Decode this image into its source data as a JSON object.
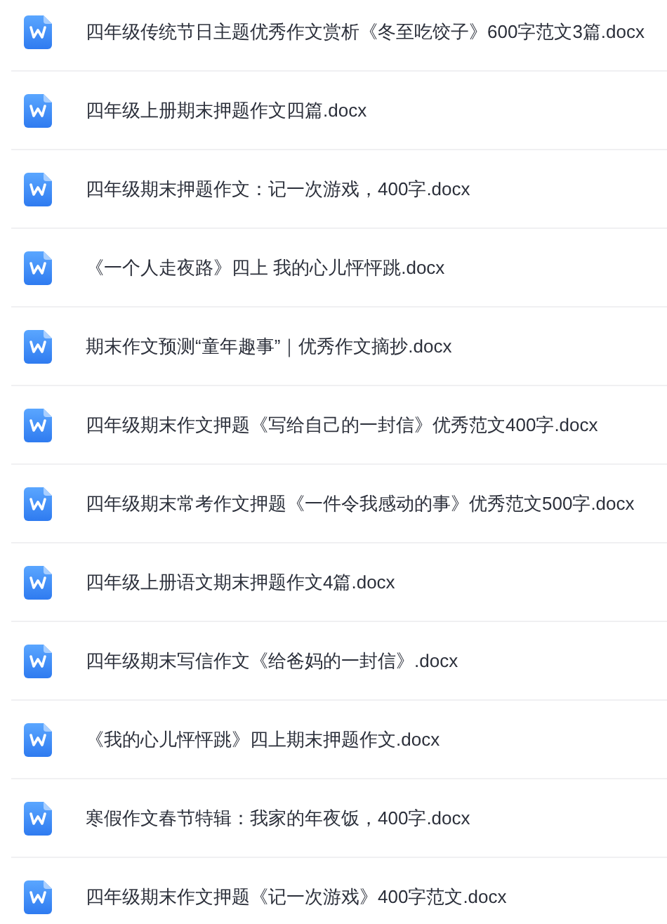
{
  "files": [
    {
      "name": "四年级传统节日主题优秀作文赏析《冬至吃饺子》600字范文3篇.docx",
      "kind": "word"
    },
    {
      "name": "四年级上册期末押题作文四篇.docx",
      "kind": "word"
    },
    {
      "name": "四年级期末押题作文：记一次游戏，400字.docx",
      "kind": "word"
    },
    {
      "name": "《一个人走夜路》四上 我的心儿怦怦跳.docx",
      "kind": "word"
    },
    {
      "name": "期末作文预测“童年趣事”｜优秀作文摘抄.docx",
      "kind": "word"
    },
    {
      "name": "四年级期末作文押题《写给自己的一封信》优秀范文400字.docx",
      "kind": "word"
    },
    {
      "name": "四年级期末常考作文押题《一件令我感动的事》优秀范文500字.docx",
      "kind": "word"
    },
    {
      "name": "四年级上册语文期末押题作文4篇.docx",
      "kind": "word"
    },
    {
      "name": "四年级期末写信作文《给爸妈的一封信》.docx",
      "kind": "word"
    },
    {
      "name": "《我的心儿怦怦跳》四上期末押题作文.docx",
      "kind": "word"
    },
    {
      "name": "寒假作文春节特辑：我家的年夜饭，400字.docx",
      "kind": "word"
    },
    {
      "name": "四年级期末作文押题《记一次游戏》400字范文.docx",
      "kind": "word"
    }
  ]
}
